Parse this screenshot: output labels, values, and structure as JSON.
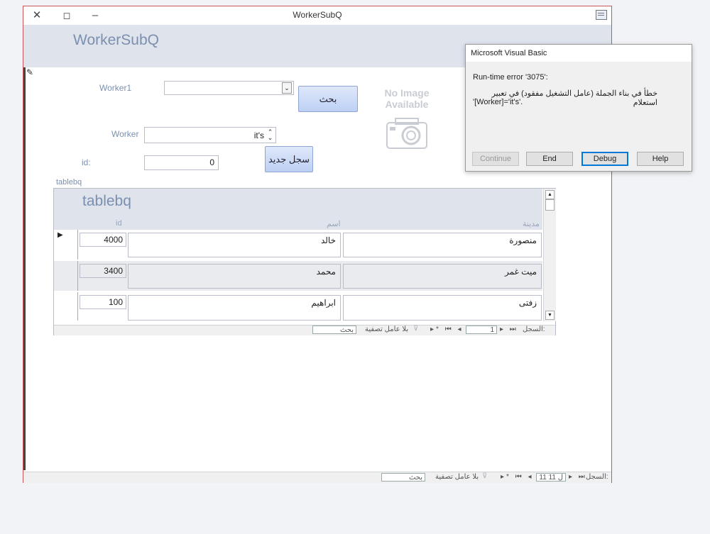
{
  "window": {
    "title": "WorkerSubQ",
    "close_glyph": "✕",
    "restore_glyph": "◻",
    "minimize_glyph": "–"
  },
  "form": {
    "title": "WorkerSubQ",
    "worker1_label": "Worker1",
    "worker1_value": "",
    "search_button": "بحث",
    "worker_label": "Worker",
    "worker_value": "it's",
    "new_record_button": "سجل جديد",
    "id_label": "id:",
    "id_value": "0",
    "no_image_line1": "No Image",
    "no_image_line2": "Available",
    "subform_label": "tablebq"
  },
  "subform": {
    "title": "tablebq",
    "columns": {
      "id": "id",
      "name": "اسم",
      "city": "مدينة"
    },
    "rows": [
      {
        "id": "4000",
        "name": "خالد",
        "city": "منصورة"
      },
      {
        "id": "3400",
        "name": "محمد",
        "city": "ميت غمر"
      },
      {
        "id": "100",
        "name": "ابراهيم",
        "city": "زفتى"
      }
    ],
    "nav": {
      "record_label": "السجل:",
      "current": "1",
      "filter_text": "بلا عامل تصفية",
      "search_text": "بحث"
    }
  },
  "main_nav": {
    "record_label": "السجل:",
    "position": "11 ل 11",
    "filter_text": "بلا عامل تصفية",
    "search_text": "بحث"
  },
  "dialog": {
    "title": "Microsoft Visual Basic",
    "error_line": "Run-time error '3075':",
    "message_line1": "خطأ في بناء الجملة (عامل التشغيل مفقود) في تعبير استعلام",
    "message_line2": "'[Worker]='it's'.",
    "buttons": {
      "continue": "Continue",
      "end": "End",
      "debug": "Debug",
      "help": "Help"
    }
  },
  "colors": {
    "accent_text": "#7b8fb0",
    "header_band": "#dfe3ec",
    "window_border": "#c8555a"
  }
}
